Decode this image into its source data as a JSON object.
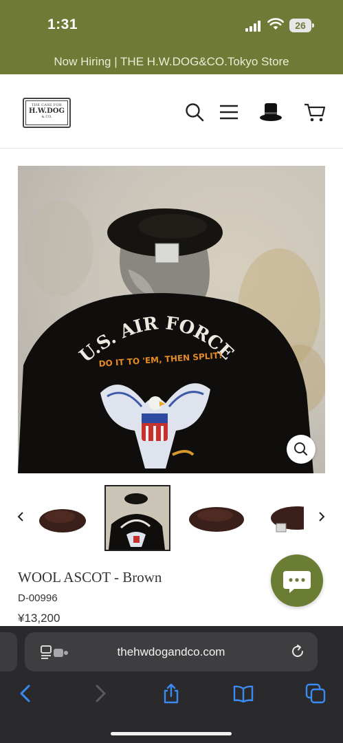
{
  "status_bar": {
    "time": "1:31",
    "battery": "26"
  },
  "announcement": "Now Hiring | THE H.W.DOG&CO.Tokyo Store",
  "logo": {
    "line1": "THE CASE FOR",
    "line2": "H.W.DOG",
    "line3": "& CO."
  },
  "header_icons": [
    "search-icon",
    "menu-icon",
    "top-hat-icon",
    "cart-icon"
  ],
  "product": {
    "jacket_text": "U.S. AIR FORCE",
    "jacket_subtext": "DO IT TO 'EM, THEN SPLIT!",
    "title": "WOOL ASCOT - Brown",
    "sku": "D-00996",
    "price": "¥13,200"
  },
  "browser": {
    "url": "thehwdogandco.com"
  },
  "colors": {
    "brand_olive": "#6e7a35",
    "chat_green": "#6b7c35",
    "safari_bg": "#2a2a2c",
    "safari_blue": "#3a8cf5"
  }
}
